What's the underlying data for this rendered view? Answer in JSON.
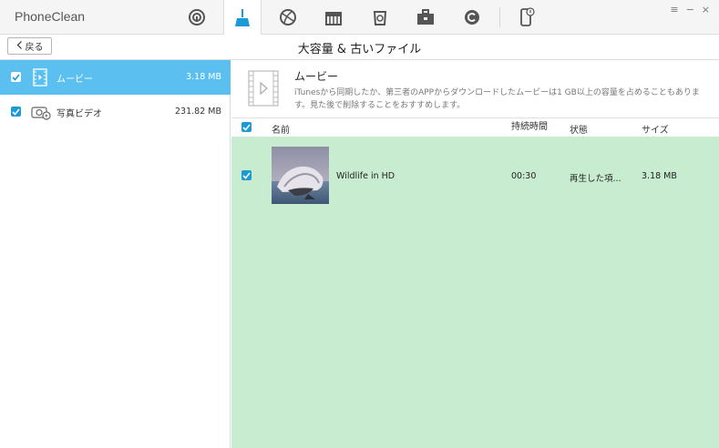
{
  "app": {
    "title": "PhoneClean"
  },
  "toolbar": {
    "tools": [
      {
        "name": "quick-clean-icon"
      },
      {
        "name": "clean-icon",
        "active": true
      },
      {
        "name": "internet-clean-icon"
      },
      {
        "name": "privacy-clean-icon"
      },
      {
        "name": "recycle-icon"
      },
      {
        "name": "toolbox-icon"
      },
      {
        "name": "copyright-icon"
      },
      {
        "name": "device-info-icon"
      }
    ],
    "window_buttons": [
      "≡",
      "−",
      "×"
    ]
  },
  "header": {
    "back_label": "戻る",
    "title": "大容量 & 古いファイル"
  },
  "sidebar": {
    "items": [
      {
        "label": "ムービー",
        "size": "3.18 MB",
        "icon": "movie-icon",
        "selected": true
      },
      {
        "label": "写真ビデオ",
        "size": "231.82 MB",
        "icon": "photo-video-icon",
        "selected": false
      }
    ]
  },
  "info": {
    "title": "ムービー",
    "description": "iTunesから同期したか、第三者のAPPからダウンロードしたムービーは1 GB以上の容量を占めることもあります。見た後で削除することをおすすめします。"
  },
  "table": {
    "columns": {
      "name": "名前",
      "duration": "持続時間",
      "status": "状態",
      "size": "サイズ"
    },
    "rows": [
      {
        "name": "Wildlife in HD",
        "duration": "00:30",
        "status": "再生した項...",
        "size": "3.18 MB"
      }
    ]
  },
  "colors": {
    "accent": "#5bc0f0",
    "check": "#1a9ad6",
    "table_bg": "#c8ecd0"
  }
}
